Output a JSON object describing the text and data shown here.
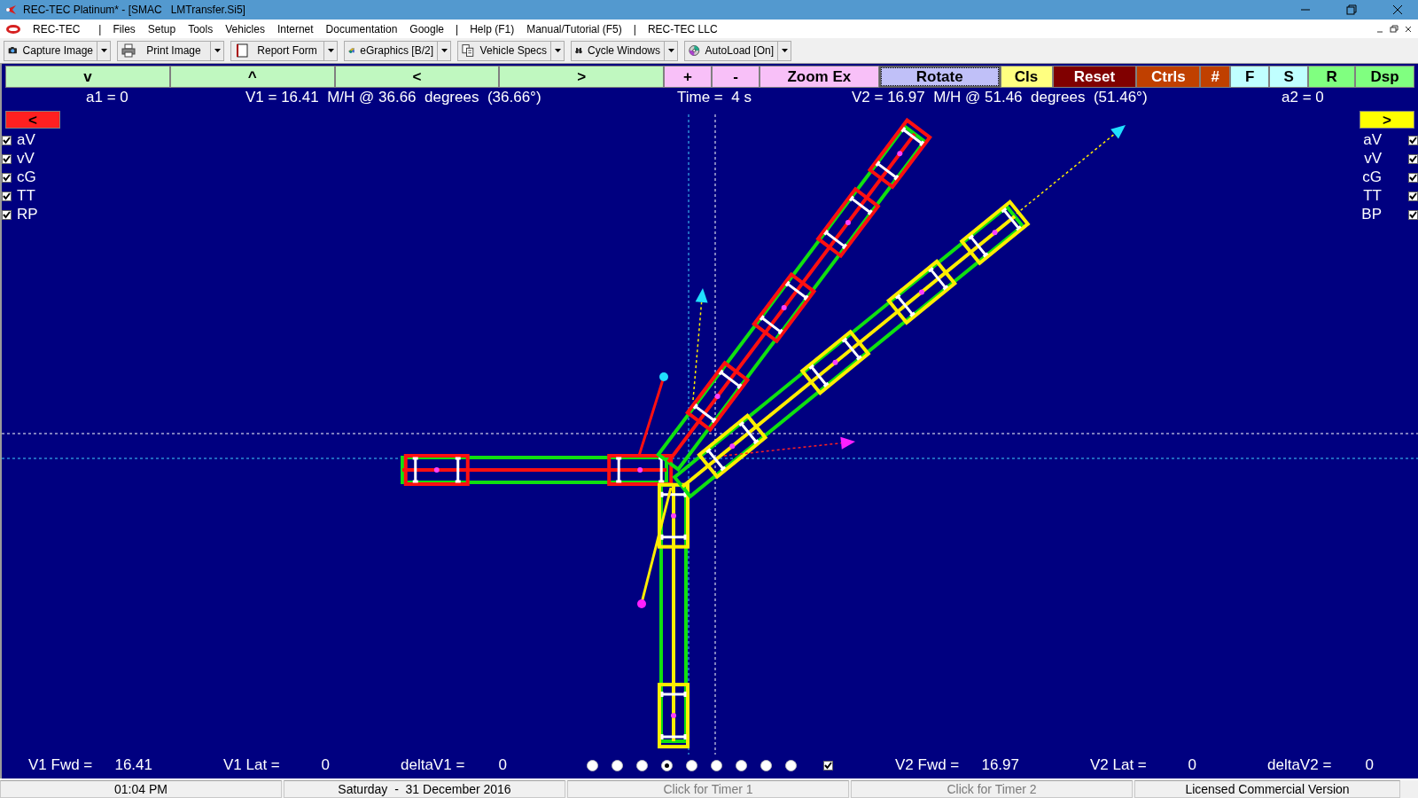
{
  "window": {
    "title": "REC-TEC Platinum* - [SMAC   LMTransfer.Si5]"
  },
  "menu": [
    {
      "label": "REC-TEC",
      "kind": "logo"
    },
    {
      "label": "|",
      "kind": "separator"
    },
    {
      "label": "Files",
      "kind": "item"
    },
    {
      "label": "Setup",
      "kind": "item"
    },
    {
      "label": "Tools",
      "kind": "item"
    },
    {
      "label": "Vehicles",
      "kind": "item"
    },
    {
      "label": "Internet",
      "kind": "item"
    },
    {
      "label": "Documentation",
      "kind": "item"
    },
    {
      "label": "Google",
      "kind": "item"
    },
    {
      "label": "|",
      "kind": "separator"
    },
    {
      "label": "Help (F1)",
      "kind": "item"
    },
    {
      "label": "Manual/Tutorial (F5)",
      "kind": "item"
    },
    {
      "label": "|",
      "kind": "separator"
    },
    {
      "label": "REC-TEC LLC",
      "kind": "item"
    }
  ],
  "toolbar": [
    {
      "label": "Capture Image",
      "kind": "camera"
    },
    {
      "label": "Print Image",
      "kind": "printer"
    },
    {
      "label": "Report Form",
      "kind": "page"
    },
    {
      "label": "eGraphics [B/2]",
      "kind": "graphics"
    },
    {
      "label": "Vehicle Specs",
      "kind": "copy"
    },
    {
      "label": "Cycle Windows",
      "kind": "binoculars"
    },
    {
      "label": "AutoLoad [On]",
      "kind": "disc"
    }
  ],
  "controls": [
    {
      "label": "v",
      "color": "#c0f8c0",
      "selected": false
    },
    {
      "label": "^",
      "color": "#c0f8c0",
      "selected": false
    },
    {
      "label": "<",
      "color": "#c0f8c0",
      "selected": false
    },
    {
      "label": ">",
      "color": "#c0f8c0",
      "selected": false
    },
    {
      "label": "+",
      "color": "#f8c0f8",
      "selected": false
    },
    {
      "label": "-",
      "color": "#f8c0f8",
      "selected": false
    },
    {
      "label": "Zoom Ex",
      "color": "#f8c0f8",
      "selected": false
    },
    {
      "label": "Rotate",
      "color": "#c0c0f8",
      "selected": true
    },
    {
      "label": "Cls",
      "color": "#ffff80",
      "selected": false
    },
    {
      "label": "Reset",
      "color": "#800000",
      "selected": false
    },
    {
      "label": "Ctrls",
      "color": "#c04000",
      "selected": false
    },
    {
      "label": "#",
      "color": "#c04000",
      "selected": false
    },
    {
      "label": "F",
      "color": "#c0ffff",
      "selected": false
    },
    {
      "label": "S",
      "color": "#c0ffff",
      "selected": false
    },
    {
      "label": "R",
      "color": "#80ff80",
      "selected": false
    },
    {
      "label": "Dsp",
      "color": "#80ff80",
      "selected": false
    }
  ],
  "readout_top": [
    "a1 = 0",
    "V1 = 16.41  M/H @ 36.66  degrees  (36.66°)",
    "Time =  4 s",
    "V2 = 16.97  M/H @ 51.46  degrees  (51.46°)",
    "a2 = 0"
  ],
  "left_panel": {
    "button": {
      "label": "<",
      "color": "#ff2020"
    },
    "options": [
      {
        "label": "aV",
        "checked": true
      },
      {
        "label": "vV",
        "checked": true
      },
      {
        "label": "cG",
        "checked": true
      },
      {
        "label": "TT",
        "checked": true
      },
      {
        "label": "RP",
        "checked": true
      }
    ]
  },
  "right_panel": {
    "button": {
      "label": ">",
      "color": "#ffff00"
    },
    "options": [
      {
        "label": "aV",
        "checked": true
      },
      {
        "label": "vV",
        "checked": true
      },
      {
        "label": "cG",
        "checked": true
      },
      {
        "label": "TT",
        "checked": true
      },
      {
        "label": "BP",
        "checked": true
      }
    ]
  },
  "readout_bottom_left": [
    {
      "label": "V1 Fwd =",
      "value": "16.41"
    },
    {
      "label": "V1 Lat =",
      "value": "0"
    },
    {
      "label": "deltaV1 =",
      "value": "0"
    }
  ],
  "steps": [
    {
      "selected": false
    },
    {
      "selected": false
    },
    {
      "selected": false
    },
    {
      "selected": true
    },
    {
      "selected": false
    },
    {
      "selected": false
    },
    {
      "selected": false
    },
    {
      "selected": false
    },
    {
      "selected": false
    }
  ],
  "step_check": {
    "checked": true
  },
  "readout_bottom_right": [
    {
      "label": "V2 Fwd =",
      "value": "16.97"
    },
    {
      "label": "V2 Lat =",
      "value": "0"
    },
    {
      "label": "deltaV2 =",
      "value": "0"
    }
  ],
  "status_bar": [
    {
      "text": "01:04 PM",
      "kind": "text"
    },
    {
      "text": "Saturday  -  31 December 2016",
      "kind": "text"
    },
    {
      "text": "Click for Timer 1",
      "kind": "button"
    },
    {
      "text": "Click for Timer 2",
      "kind": "button"
    },
    {
      "text": "Licensed Commercial Version",
      "kind": "text"
    }
  ]
}
